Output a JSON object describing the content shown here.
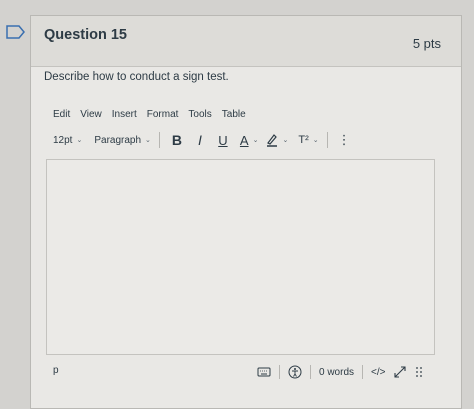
{
  "question": {
    "title": "Question 15",
    "points": "5 pts",
    "prompt": "Describe how to conduct a sign test."
  },
  "menubar": {
    "items": [
      "Edit",
      "View",
      "Insert",
      "Format",
      "Tools",
      "Table"
    ]
  },
  "toolbar": {
    "font_size": "12pt",
    "block_format": "Paragraph",
    "bold": "B",
    "italic": "I",
    "underline": "U",
    "text_color": "A",
    "superscript": "T²",
    "more": "⋮"
  },
  "statusbar": {
    "path": "p",
    "word_count": "0 words",
    "html_toggle": "</>"
  },
  "colors": {
    "page_bg": "#d3d2cf",
    "card_bg": "#e9e8e5",
    "header_bg": "#dddcd8",
    "text": "#2d3b45"
  },
  "icons": {
    "flag": "flag-icon",
    "keyboard": "keyboard-icon",
    "accessibility": "accessibility-icon",
    "fullscreen": "fullscreen-icon",
    "resize": "resize-handle-icon"
  }
}
